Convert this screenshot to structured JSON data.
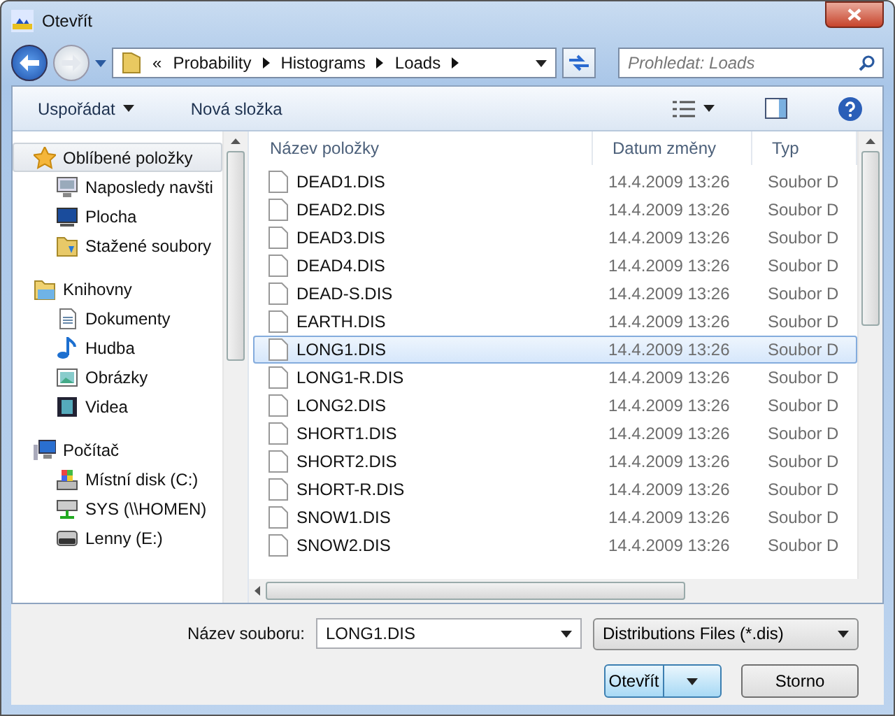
{
  "window": {
    "title": "Otevřít"
  },
  "address": {
    "overflow": "«",
    "segments": [
      "Probability",
      "Histograms",
      "Loads"
    ]
  },
  "search": {
    "placeholder": "Prohledat: Loads"
  },
  "toolbar": {
    "organize": "Uspořádat",
    "new_folder": "Nová složka"
  },
  "sidebar": {
    "groups": [
      {
        "label": "Oblíbené položky",
        "kind": "star",
        "selected": true,
        "items": [
          {
            "label": "Naposledy navšti",
            "kind": "recent"
          },
          {
            "label": "Plocha",
            "kind": "desktop"
          },
          {
            "label": "Stažené soubory",
            "kind": "download"
          }
        ]
      },
      {
        "label": "Knihovny",
        "kind": "library",
        "selected": false,
        "items": [
          {
            "label": "Dokumenty",
            "kind": "document"
          },
          {
            "label": "Hudba",
            "kind": "music"
          },
          {
            "label": "Obrázky",
            "kind": "picture"
          },
          {
            "label": "Videa",
            "kind": "video"
          }
        ]
      },
      {
        "label": "Počítač",
        "kind": "computer",
        "selected": false,
        "items": [
          {
            "label": "Místní disk (C:)",
            "kind": "disk"
          },
          {
            "label": "SYS (\\\\HOMEN)",
            "kind": "network"
          },
          {
            "label": "Lenny (E:)",
            "kind": "drive"
          }
        ]
      }
    ]
  },
  "columns": [
    "Název položky",
    "Datum změny",
    "Typ"
  ],
  "rows": [
    {
      "name": "DEAD1.DIS",
      "date": "14.4.2009 13:26",
      "type": "Soubor D",
      "selected": false
    },
    {
      "name": "DEAD2.DIS",
      "date": "14.4.2009 13:26",
      "type": "Soubor D",
      "selected": false
    },
    {
      "name": "DEAD3.DIS",
      "date": "14.4.2009 13:26",
      "type": "Soubor D",
      "selected": false
    },
    {
      "name": "DEAD4.DIS",
      "date": "14.4.2009 13:26",
      "type": "Soubor D",
      "selected": false
    },
    {
      "name": "DEAD-S.DIS",
      "date": "14.4.2009 13:26",
      "type": "Soubor D",
      "selected": false
    },
    {
      "name": "EARTH.DIS",
      "date": "14.4.2009 13:26",
      "type": "Soubor D",
      "selected": false
    },
    {
      "name": "LONG1.DIS",
      "date": "14.4.2009 13:26",
      "type": "Soubor D",
      "selected": true
    },
    {
      "name": "LONG1-R.DIS",
      "date": "14.4.2009 13:26",
      "type": "Soubor D",
      "selected": false
    },
    {
      "name": "LONG2.DIS",
      "date": "14.4.2009 13:26",
      "type": "Soubor D",
      "selected": false
    },
    {
      "name": "SHORT1.DIS",
      "date": "14.4.2009 13:26",
      "type": "Soubor D",
      "selected": false
    },
    {
      "name": "SHORT2.DIS",
      "date": "14.4.2009 13:26",
      "type": "Soubor D",
      "selected": false
    },
    {
      "name": "SHORT-R.DIS",
      "date": "14.4.2009 13:26",
      "type": "Soubor D",
      "selected": false
    },
    {
      "name": "SNOW1.DIS",
      "date": "14.4.2009 13:26",
      "type": "Soubor D",
      "selected": false
    },
    {
      "name": "SNOW2.DIS",
      "date": "14.4.2009 13:26",
      "type": "Soubor D",
      "selected": false
    }
  ],
  "footer": {
    "filename_label": "Název souboru:",
    "filename": "LONG1.DIS",
    "filter": "Distributions Files (*.dis)",
    "open": "Otevřít",
    "cancel": "Storno"
  }
}
